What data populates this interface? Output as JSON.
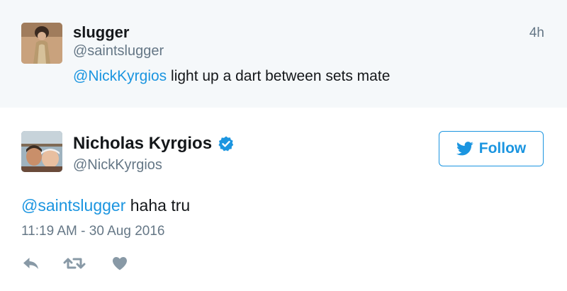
{
  "parent_tweet": {
    "display_name": "slugger",
    "handle": "@saintslugger",
    "time_ago": "4h",
    "mention": "@NickKyrgios",
    "text": " light up a dart between sets mate"
  },
  "main_tweet": {
    "display_name": "Nicholas Kyrgios",
    "verified": true,
    "handle": "@NickKyrgios",
    "follow_label": "Follow",
    "mention": "@saintslugger",
    "text": " haha tru",
    "timestamp": "11:19 AM - 30 Aug 2016"
  },
  "icons": {
    "follow": "twitter-bird-icon",
    "verified": "verified-badge-icon",
    "reply": "reply-icon",
    "retweet": "retweet-icon",
    "like": "heart-icon"
  },
  "colors": {
    "accent": "#1b95e0",
    "parent_background": "#f5f8fa",
    "secondary_text": "#657786",
    "action_icons": "#8899a6"
  }
}
